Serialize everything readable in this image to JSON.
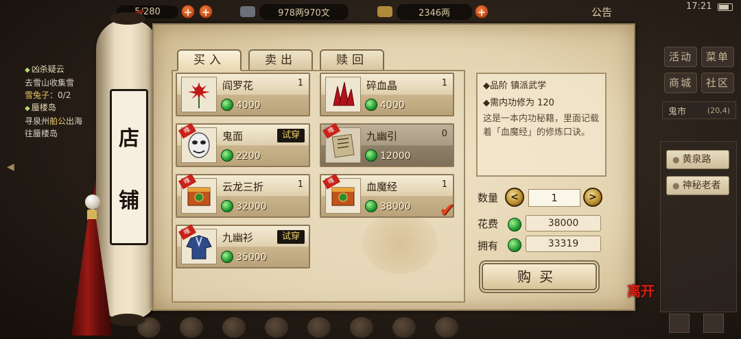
{
  "topbar": {
    "bag": "5/280",
    "copper": "978两970文",
    "silver": "2346两",
    "notice": "公告",
    "clock": "17:21"
  },
  "quest": {
    "title1": "凶杀疑云",
    "line1": "去雪山收集雪",
    "line2_hl": "雪兔子",
    "line2": "：0/2",
    "title2": "蜃楼岛",
    "line3a": "寻泉州",
    "line3_hl": "舶公",
    "line3b": "出海",
    "line4": "往蜃楼岛"
  },
  "right_menu": {
    "activity": "活动",
    "menu": "菜单",
    "mall": "商城",
    "community": "社区",
    "location": "鬼市",
    "coords": "(20,4)",
    "npc1": "黄泉路",
    "npc2": "神秘老者"
  },
  "shop": {
    "sign": [
      "店",
      "铺"
    ],
    "tabs": [
      "买入",
      "卖出",
      "赎回"
    ],
    "try_label": "试穿",
    "only_label": "唯",
    "items": [
      {
        "name": "阎罗花",
        "qty": "1",
        "price": "4000"
      },
      {
        "name": "碎血晶",
        "qty": "1",
        "price": "4000"
      },
      {
        "name": "鬼面",
        "qty": "",
        "price": "2200"
      },
      {
        "name": "九幽引",
        "qty": "0",
        "price": "12000"
      },
      {
        "name": "云龙三折",
        "qty": "1",
        "price": "32000"
      },
      {
        "name": "血魔经",
        "qty": "1",
        "price": "38000"
      },
      {
        "name": "九幽衫",
        "qty": "",
        "price": "35000"
      }
    ],
    "check_mark": "✔"
  },
  "detail": {
    "grade": "◆品阶 镇派武学",
    "requirement": "◆需内功修为 120",
    "description": "这是一本内功秘籍，里面记载着「血魔经」的修炼口诀。"
  },
  "purchase": {
    "qty_label": "数量",
    "qty_value": "1",
    "cost_label": "花费",
    "cost_value": "38000",
    "own_label": "拥有",
    "own_value": "33319",
    "buy_label": "购买",
    "leave_label": "离开"
  },
  "colors": {
    "parchment": "#e3d3b0",
    "accent_red": "#d81e12",
    "gem_green": "#1f9a32"
  }
}
